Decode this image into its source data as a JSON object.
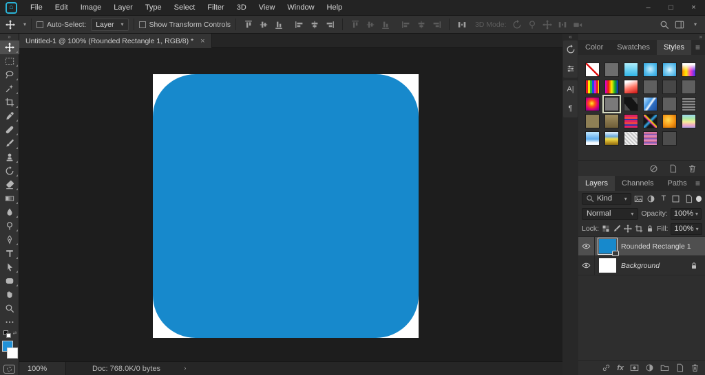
{
  "icons": {
    "home": "⌂",
    "dropdown_chevron": "▾",
    "double_chevron_left": "«",
    "double_chevron_right": "»",
    "hamburger": "≡",
    "close": "×",
    "minimize": "–",
    "maximize": "□",
    "ellipsis": "⋯",
    "status_expand": "›",
    "swap_colors": "⇄",
    "fx": "fx",
    "character_panel": "A|",
    "paragraph_panel": "¶",
    "type_filter": "T"
  },
  "titlebar": {
    "menus": [
      "File",
      "Edit",
      "Image",
      "Layer",
      "Type",
      "Select",
      "Filter",
      "3D",
      "View",
      "Window",
      "Help"
    ]
  },
  "options_bar": {
    "auto_select_label": "Auto-Select:",
    "auto_select_checked": false,
    "auto_select_target": "Layer",
    "show_transform_label": "Show Transform Controls",
    "show_transform_checked": false,
    "mode_3d_label": "3D Mode:"
  },
  "toolbar": {
    "tools": [
      "move",
      "rectangular-marquee",
      "lasso",
      "quick-selection",
      "crop",
      "eyedropper",
      "spot-healing-brush",
      "brush",
      "clone-stamp",
      "history-brush",
      "eraser",
      "gradient",
      "blur",
      "dodge",
      "pen",
      "horizontal-type",
      "path-selection",
      "rectangle-shape",
      "hand",
      "zoom",
      "edit-toolbar"
    ],
    "selected_tool": "move",
    "foreground_color": "#2191d6",
    "background_color": "#ffffff"
  },
  "document": {
    "tab_title": "Untitled-1 @ 100% (Rounded Rectangle 1, RGB/8) *",
    "canvas_background": "#ffffff",
    "shape_fill": "#1789cc",
    "shape_corner_radius_px": 62
  },
  "styles_panel": {
    "tabs": [
      "Color",
      "Swatches",
      "Styles"
    ],
    "active_tab": "Styles",
    "swatches": [
      {
        "name": "no-style",
        "bg": "#ffffff",
        "slash": true
      },
      {
        "name": "gray-1",
        "bg": "#6e6e6e"
      },
      {
        "name": "cyan-gradient",
        "bg": "linear-gradient(180deg,#aeeefc 0%,#30b6e8 100%)"
      },
      {
        "name": "blue-bevel",
        "bg": "radial-gradient(circle at 50% 45%,#cfeffc 0%,#56bdec 55%,#2ba0dc 100%)"
      },
      {
        "name": "blue-glow",
        "bg": "radial-gradient(circle at 50% 50%,#eafaff 0%,#8ed4f4 35%,#2ea4e0 100%)"
      },
      {
        "name": "rainbow-white",
        "bg": "linear-gradient(180deg,rgba(255,255,255,1) 10%,rgba(255,255,255,0) 60%),linear-gradient(90deg,#ff8800,#ffee00 30%,#ee33cc 65%,#4433ee)"
      },
      {
        "name": "rainbow-stripes",
        "bg": "repeating-linear-gradient(90deg,#ee2222 0px,#ee2222 3px,#ffee00 3px,#ffee00 6px,#22bb44 6px,#22bb44 9px,#2244ee 9px,#2244ee 12px,#cc22cc 12px,#cc22cc 15px)"
      },
      {
        "name": "spectrum",
        "bg": "linear-gradient(90deg,#dd00dd,#ee2200 25%,#ffee00 50%,#11aa22 75%,#1122cc)"
      },
      {
        "name": "red-white-fade",
        "bg": "linear-gradient(160deg,#ffffff 15%,#ff7766 55%,#cc1111 100%)"
      },
      {
        "name": "gray-2",
        "bg": "#5f5f5f"
      },
      {
        "name": "gray-3",
        "bg": "#474747"
      },
      {
        "name": "gray-4",
        "bg": "#5f5f5f"
      },
      {
        "name": "orange-purple-radial",
        "bg": "radial-gradient(circle at 45% 45%,#ffee33 0%,#ff5511 30%,#dd0077 60%,#660099 100%)"
      },
      {
        "name": "texture-gray",
        "bg": "#7a7a7a",
        "selected": true
      },
      {
        "name": "black-chevron",
        "bg": "linear-gradient(50deg,#4a4a4a 25%,#141414 25%,#141414 75%,#4a4a4a 75%)"
      },
      {
        "name": "blue-sky",
        "bg": "linear-gradient(125deg,#bfe4ff 0%,#4496e4 40%,#ffffff 52%,#2e6fc4 60%,#1d4f9c 100%)"
      },
      {
        "name": "gray-5",
        "bg": "#5f5f5f"
      },
      {
        "name": "gray-lines",
        "bg": "repeating-linear-gradient(0deg,#8a8a8a 0px,#8a8a8a 2px,#3c3c3c 2px,#3c3c3c 4px)"
      },
      {
        "name": "khaki",
        "bg": "#8e7f55"
      },
      {
        "name": "tan-gradient",
        "bg": "linear-gradient(180deg,#a08e60,#6f5e38)"
      },
      {
        "name": "magenta-stripes",
        "bg": "repeating-linear-gradient(0deg,#dd2266 0px,#dd2266 3px,#3333aa 3px,#3333aa 5px,#ee4444 5px,#ee4444 8px)"
      },
      {
        "name": "color-burst",
        "bg": "linear-gradient(45deg,rgba(0,0,0,0) 40%,#ee33aa 47%,#ffdd00 53%,rgba(0,0,0,0) 60%),linear-gradient(135deg,#161616 38%,#33aaee 50%,#161616 62%)"
      },
      {
        "name": "gold",
        "bg": "radial-gradient(circle at 40% 40%,#ffd84e 0%,#f59414 55%,#b35f00 100%)"
      },
      {
        "name": "pastel-rainbow",
        "bg": "linear-gradient(180deg,#9cd6f0 0%,#aae8a4 30%,#f6ee96 55%,#f0a8c8 80%,#b0a2e2 100%)"
      },
      {
        "name": "sky-clouds",
        "bg": "linear-gradient(180deg,#c2e8ff 0%,#5facec 55%,#ffffff 85%,#e8f4ff 100%)"
      },
      {
        "name": "sand-sky",
        "bg": "linear-gradient(180deg,#eaf6ff 0%,#6aaae0 35%,#f2dc48 55%,#c09a22 80%,#8a6c14 100%)"
      },
      {
        "name": "white-weave",
        "bg": "repeating-linear-gradient(45deg,#f2f2f2 0px,#f2f2f2 2px,#c6c6c6 2px,#c6c6c6 4px)"
      },
      {
        "name": "pink-stripes",
        "bg": "repeating-linear-gradient(0deg,#e688b8 0px,#e688b8 2px,#8a5cb4 2px,#8a5cb4 4px,#c46a94 4px,#c46a94 6px)"
      },
      {
        "name": "gray-6",
        "bg": "#4d4d4d"
      }
    ]
  },
  "layers_panel": {
    "tabs": [
      "Layers",
      "Channels",
      "Paths"
    ],
    "active_tab": "Layers",
    "kind_filter_value": "Kind",
    "blend_mode_value": "Normal",
    "opacity_label": "Opacity:",
    "opacity_value": "100%",
    "lock_label": "Lock:",
    "fill_label": "Fill:",
    "fill_value": "100%",
    "layers": [
      {
        "name": "Rounded Rectangle 1",
        "visible": true,
        "selected": true,
        "kind": "shape",
        "thumb": "#1789cc"
      },
      {
        "name": "Background",
        "visible": true,
        "locked": true,
        "kind": "background",
        "thumb": "#ffffff"
      }
    ]
  },
  "status_bar": {
    "zoom_level": "100%",
    "doc_info": "Doc: 768.0K/0 bytes"
  }
}
